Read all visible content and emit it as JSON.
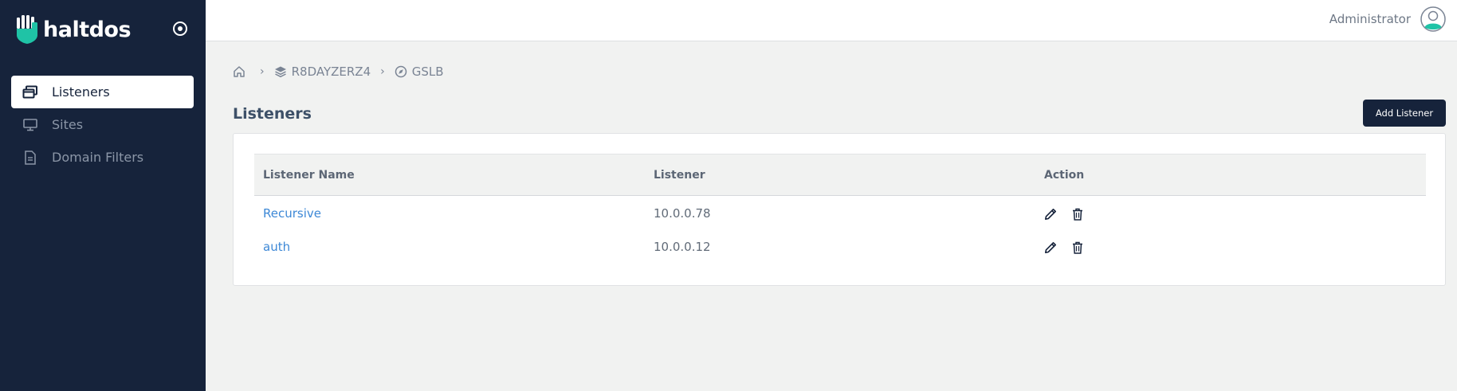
{
  "brand": {
    "name": "haltdos",
    "accent": "#1fc3a6"
  },
  "sidebar": {
    "items": [
      {
        "label": "Listeners",
        "icon": "windows-stack-icon",
        "active": true
      },
      {
        "label": "Sites",
        "icon": "monitor-icon",
        "active": false
      },
      {
        "label": "Domain Filters",
        "icon": "document-icon",
        "active": false
      }
    ]
  },
  "header": {
    "user_name": "Administrator"
  },
  "breadcrumb": {
    "home_icon": "home-icon",
    "items": [
      {
        "label": "R8DAYZERZ4",
        "icon": "layers-icon"
      },
      {
        "label": "GSLB",
        "icon": "compass-icon"
      }
    ]
  },
  "page": {
    "title": "Listeners",
    "add_button_label": "Add Listener"
  },
  "table": {
    "columns": [
      "Listener Name",
      "Listener",
      "Action"
    ],
    "rows": [
      {
        "name": "Recursive",
        "listener": "10.0.0.78"
      },
      {
        "name": "auth",
        "listener": "10.0.0.12"
      }
    ]
  },
  "colors": {
    "sidebar_bg": "#16233b",
    "link": "#3d88d6",
    "page_bg": "#f1f2f1"
  }
}
